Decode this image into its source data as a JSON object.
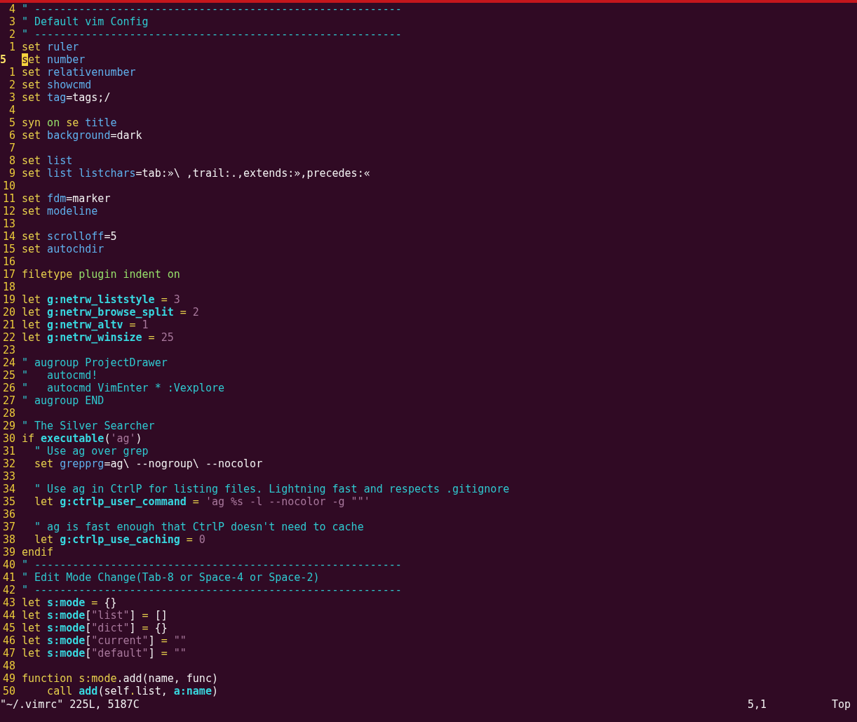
{
  "editor": {
    "lines": [
      {
        "number": "4",
        "current": false,
        "tokens": [
          {
            "kind": "comment",
            "text": "\" ----------------------------------------------------------"
          }
        ]
      },
      {
        "number": "3",
        "current": false,
        "tokens": [
          {
            "kind": "comment",
            "text": "\" Default vim Config"
          }
        ]
      },
      {
        "number": "2",
        "current": false,
        "tokens": [
          {
            "kind": "comment",
            "text": "\" ----------------------------------------------------------"
          }
        ]
      },
      {
        "number": "1",
        "current": false,
        "tokens": [
          {
            "kind": "keyword",
            "text": "set"
          },
          {
            "kind": "option",
            "text": " ruler"
          }
        ]
      },
      {
        "number": "5",
        "current": true,
        "tokens": [
          {
            "kind": "cursor",
            "text": "s"
          },
          {
            "kind": "keyword",
            "text": "et"
          },
          {
            "kind": "option",
            "text": " number"
          }
        ]
      },
      {
        "number": "1",
        "current": false,
        "tokens": [
          {
            "kind": "keyword",
            "text": "set"
          },
          {
            "kind": "option",
            "text": " relativenumber"
          }
        ]
      },
      {
        "number": "2",
        "current": false,
        "tokens": [
          {
            "kind": "keyword",
            "text": "set"
          },
          {
            "kind": "option",
            "text": " showcmd"
          }
        ]
      },
      {
        "number": "3",
        "current": false,
        "tokens": [
          {
            "kind": "keyword",
            "text": "set"
          },
          {
            "kind": "option",
            "text": " tag"
          },
          {
            "kind": "plain",
            "text": "=tags;/"
          }
        ]
      },
      {
        "number": "4",
        "current": false
      },
      {
        "number": "5",
        "current": false,
        "tokens": [
          {
            "kind": "keyword",
            "text": "syn"
          },
          {
            "kind": "special",
            "text": " on"
          },
          {
            "kind": "keyword",
            "text": " se"
          },
          {
            "kind": "option",
            "text": " title"
          }
        ]
      },
      {
        "number": "6",
        "current": false,
        "tokens": [
          {
            "kind": "keyword",
            "text": "set"
          },
          {
            "kind": "option",
            "text": " background"
          },
          {
            "kind": "plain",
            "text": "=dark"
          }
        ]
      },
      {
        "number": "7",
        "current": false
      },
      {
        "number": "8",
        "current": false,
        "tokens": [
          {
            "kind": "keyword",
            "text": "set"
          },
          {
            "kind": "option",
            "text": " list"
          }
        ]
      },
      {
        "number": "9",
        "current": false,
        "tokens": [
          {
            "kind": "keyword",
            "text": "set"
          },
          {
            "kind": "option",
            "text": " list listchars"
          },
          {
            "kind": "plain",
            "text": "=tab:»\\ ,trail:.,extends:»,precedes:«"
          }
        ]
      },
      {
        "number": "10",
        "current": false
      },
      {
        "number": "11",
        "current": false,
        "tokens": [
          {
            "kind": "keyword",
            "text": "set"
          },
          {
            "kind": "option",
            "text": " fdm"
          },
          {
            "kind": "plain",
            "text": "=marker"
          }
        ]
      },
      {
        "number": "12",
        "current": false,
        "tokens": [
          {
            "kind": "keyword",
            "text": "set"
          },
          {
            "kind": "option",
            "text": " modeline"
          }
        ]
      },
      {
        "number": "13",
        "current": false
      },
      {
        "number": "14",
        "current": false,
        "tokens": [
          {
            "kind": "keyword",
            "text": "set"
          },
          {
            "kind": "option",
            "text": " scrolloff"
          },
          {
            "kind": "plain",
            "text": "=5"
          }
        ]
      },
      {
        "number": "15",
        "current": false,
        "tokens": [
          {
            "kind": "keyword",
            "text": "set"
          },
          {
            "kind": "option",
            "text": " autochdir"
          }
        ]
      },
      {
        "number": "16",
        "current": false
      },
      {
        "number": "17",
        "current": false,
        "tokens": [
          {
            "kind": "keyword",
            "text": "filetype"
          },
          {
            "kind": "special",
            "text": " plugin indent on"
          }
        ]
      },
      {
        "number": "18",
        "current": false
      },
      {
        "number": "19",
        "current": false,
        "tokens": [
          {
            "kind": "keyword",
            "text": "let"
          },
          {
            "kind": "ident",
            "text": " g:netrw_liststyle"
          },
          {
            "kind": "keyword",
            "text": " ="
          },
          {
            "kind": "string",
            "text": " 3"
          }
        ]
      },
      {
        "number": "20",
        "current": false,
        "tokens": [
          {
            "kind": "keyword",
            "text": "let"
          },
          {
            "kind": "ident",
            "text": " g:netrw_browse_split"
          },
          {
            "kind": "keyword",
            "text": " ="
          },
          {
            "kind": "string",
            "text": " 2"
          }
        ]
      },
      {
        "number": "21",
        "current": false,
        "tokens": [
          {
            "kind": "keyword",
            "text": "let"
          },
          {
            "kind": "ident",
            "text": " g:netrw_altv"
          },
          {
            "kind": "keyword",
            "text": " ="
          },
          {
            "kind": "string",
            "text": " 1"
          }
        ]
      },
      {
        "number": "22",
        "current": false,
        "tokens": [
          {
            "kind": "keyword",
            "text": "let"
          },
          {
            "kind": "ident",
            "text": " g:netrw_winsize"
          },
          {
            "kind": "keyword",
            "text": " ="
          },
          {
            "kind": "string",
            "text": " 25"
          }
        ]
      },
      {
        "number": "23",
        "current": false
      },
      {
        "number": "24",
        "current": false,
        "tokens": [
          {
            "kind": "comment",
            "text": "\" augroup ProjectDrawer"
          }
        ]
      },
      {
        "number": "25",
        "current": false,
        "tokens": [
          {
            "kind": "comment",
            "text": "\"   autocmd!"
          }
        ]
      },
      {
        "number": "26",
        "current": false,
        "tokens": [
          {
            "kind": "comment",
            "text": "\"   autocmd VimEnter * :Vexplore"
          }
        ]
      },
      {
        "number": "27",
        "current": false,
        "tokens": [
          {
            "kind": "comment",
            "text": "\" augroup END"
          }
        ]
      },
      {
        "number": "28",
        "current": false
      },
      {
        "number": "29",
        "current": false,
        "tokens": [
          {
            "kind": "comment",
            "text": "\" The Silver Searcher"
          }
        ]
      },
      {
        "number": "30",
        "current": false,
        "tokens": [
          {
            "kind": "keyword",
            "text": "if"
          },
          {
            "kind": "ident",
            "text": " executable"
          },
          {
            "kind": "plain",
            "text": "("
          },
          {
            "kind": "string",
            "text": "'ag'"
          },
          {
            "kind": "plain",
            "text": ")"
          }
        ]
      },
      {
        "number": "31",
        "current": false,
        "tokens": [
          {
            "kind": "comment",
            "text": "  \" Use ag over grep"
          }
        ]
      },
      {
        "number": "32",
        "current": false,
        "tokens": [
          {
            "kind": "keyword",
            "text": "  set"
          },
          {
            "kind": "option",
            "text": " grepprg"
          },
          {
            "kind": "plain",
            "text": "=ag\\ --nogroup\\ --nocolor"
          }
        ]
      },
      {
        "number": "33",
        "current": false
      },
      {
        "number": "34",
        "current": false,
        "tokens": [
          {
            "kind": "comment",
            "text": "  \" Use ag in CtrlP for listing files. Lightning fast and respects .gitignore"
          }
        ]
      },
      {
        "number": "35",
        "current": false,
        "tokens": [
          {
            "kind": "keyword",
            "text": "  let"
          },
          {
            "kind": "ident",
            "text": " g:ctrlp_user_command"
          },
          {
            "kind": "keyword",
            "text": " ="
          },
          {
            "kind": "string",
            "text": " 'ag %s -l --nocolor -g \"\"'"
          }
        ]
      },
      {
        "number": "36",
        "current": false
      },
      {
        "number": "37",
        "current": false,
        "tokens": [
          {
            "kind": "comment",
            "text": "  \" ag is fast enough that CtrlP doesn't need to cache"
          }
        ]
      },
      {
        "number": "38",
        "current": false,
        "tokens": [
          {
            "kind": "keyword",
            "text": "  let"
          },
          {
            "kind": "ident",
            "text": " g:ctrlp_use_caching"
          },
          {
            "kind": "keyword",
            "text": " ="
          },
          {
            "kind": "string",
            "text": " 0"
          }
        ]
      },
      {
        "number": "39",
        "current": false,
        "tokens": [
          {
            "kind": "keyword",
            "text": "endif"
          }
        ]
      },
      {
        "number": "40",
        "current": false,
        "tokens": [
          {
            "kind": "comment",
            "text": "\" ----------------------------------------------------------"
          }
        ]
      },
      {
        "number": "41",
        "current": false,
        "tokens": [
          {
            "kind": "comment",
            "text": "\" Edit Mode Change(Tab-8 or Space-4 or Space-2)"
          }
        ]
      },
      {
        "number": "42",
        "current": false,
        "tokens": [
          {
            "kind": "comment",
            "text": "\" ----------------------------------------------------------"
          }
        ]
      },
      {
        "number": "43",
        "current": false,
        "tokens": [
          {
            "kind": "keyword",
            "text": "let"
          },
          {
            "kind": "ident",
            "text": " s:mode"
          },
          {
            "kind": "keyword",
            "text": " ="
          },
          {
            "kind": "plain",
            "text": " {}"
          }
        ]
      },
      {
        "number": "44",
        "current": false,
        "tokens": [
          {
            "kind": "keyword",
            "text": "let"
          },
          {
            "kind": "ident",
            "text": " s:mode"
          },
          {
            "kind": "plain",
            "text": "["
          },
          {
            "kind": "string",
            "text": "\"list\""
          },
          {
            "kind": "plain",
            "text": "]"
          },
          {
            "kind": "keyword",
            "text": " ="
          },
          {
            "kind": "plain",
            "text": " []"
          }
        ]
      },
      {
        "number": "45",
        "current": false,
        "tokens": [
          {
            "kind": "keyword",
            "text": "let"
          },
          {
            "kind": "ident",
            "text": " s:mode"
          },
          {
            "kind": "plain",
            "text": "["
          },
          {
            "kind": "string",
            "text": "\"dict\""
          },
          {
            "kind": "plain",
            "text": "]"
          },
          {
            "kind": "keyword",
            "text": " ="
          },
          {
            "kind": "plain",
            "text": " {}"
          }
        ]
      },
      {
        "number": "46",
        "current": false,
        "tokens": [
          {
            "kind": "keyword",
            "text": "let"
          },
          {
            "kind": "ident",
            "text": " s:mode"
          },
          {
            "kind": "plain",
            "text": "["
          },
          {
            "kind": "string",
            "text": "\"current\""
          },
          {
            "kind": "plain",
            "text": "]"
          },
          {
            "kind": "keyword",
            "text": " ="
          },
          {
            "kind": "string",
            "text": " \"\""
          }
        ]
      },
      {
        "number": "47",
        "current": false,
        "tokens": [
          {
            "kind": "keyword",
            "text": "let"
          },
          {
            "kind": "ident",
            "text": " s:mode"
          },
          {
            "kind": "plain",
            "text": "["
          },
          {
            "kind": "string",
            "text": "\"default\""
          },
          {
            "kind": "plain",
            "text": "]"
          },
          {
            "kind": "keyword",
            "text": " ="
          },
          {
            "kind": "string",
            "text": " \"\""
          }
        ]
      },
      {
        "number": "48",
        "current": false
      },
      {
        "number": "49",
        "current": false,
        "tokens": [
          {
            "kind": "keyword",
            "text": "function s:mode"
          },
          {
            "kind": "plain",
            "text": ".add(name, func)"
          }
        ]
      },
      {
        "number": "50",
        "current": false,
        "tokens": [
          {
            "kind": "keyword",
            "text": "    call"
          },
          {
            "kind": "ident",
            "text": " add"
          },
          {
            "kind": "plain",
            "text": "(self"
          },
          {
            "kind": "keyword",
            "text": "."
          },
          {
            "kind": "plain",
            "text": "list, "
          },
          {
            "kind": "ident",
            "text": "a:name"
          },
          {
            "kind": "plain",
            "text": ")"
          }
        ]
      }
    ]
  },
  "status_bar": {
    "message": "\"~/.vimrc\" 225L, 5187C",
    "ruler": "5,1",
    "position": "Top"
  }
}
